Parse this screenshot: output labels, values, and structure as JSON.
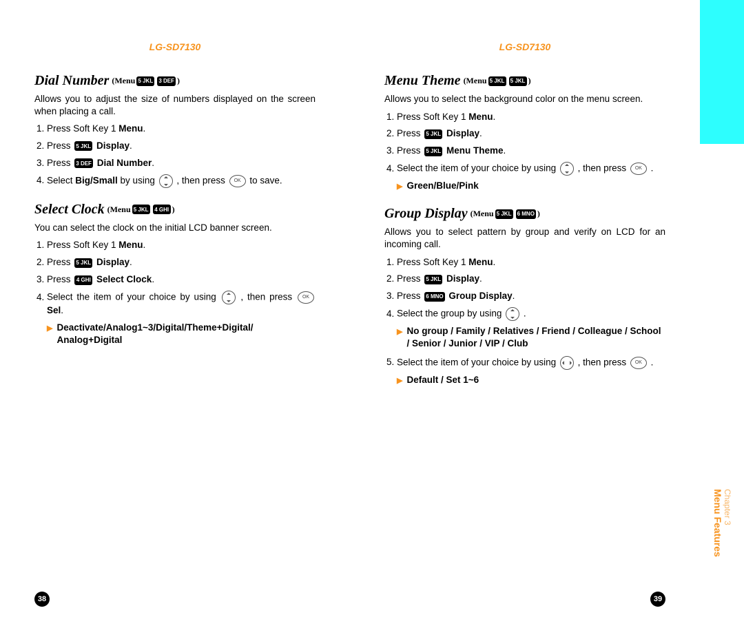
{
  "model": "LG-SD7130",
  "keys": {
    "k3": "3 DEF",
    "k4": "4 GHI",
    "k5": "5 JKL",
    "k6": "6 MNO",
    "ok": "OK"
  },
  "left": {
    "pageNum": "38",
    "sections": [
      {
        "title": "Dial Number",
        "crumbPrefix": "(Menu",
        "crumbKeys": [
          "k5",
          "k3"
        ],
        "crumbSuffix": ")",
        "desc": "Allows you to adjust the size of numbers displayed on the screen when placing a call.",
        "steps": [
          {
            "pre": "Press Soft Key 1 ",
            "bold": "Menu",
            "post": "."
          },
          {
            "pre": "Press ",
            "key": "k5",
            "bold": " Display",
            "post": "."
          },
          {
            "pre": "Press ",
            "key": "k3",
            "bold": " Dial Number",
            "post": "."
          },
          {
            "pre": "Select ",
            "bold": "Big/Small",
            "mid": " by using ",
            "nav": "vert",
            "post2": " , then press ",
            "ok": true,
            "tail": " to save."
          }
        ]
      },
      {
        "title": "Select Clock",
        "crumbPrefix": "(Menu",
        "crumbKeys": [
          "k5",
          "k4"
        ],
        "crumbSuffix": ")",
        "desc": "You can select the clock on the initial LCD banner screen.",
        "steps": [
          {
            "pre": "Press Soft Key 1 ",
            "bold": "Menu",
            "post": "."
          },
          {
            "pre": "Press ",
            "key": "k5",
            "bold": " Display",
            "post": "."
          },
          {
            "pre": "Press ",
            "key": "k4",
            "bold": " Select Clock",
            "post": "."
          },
          {
            "pre": "Select the item of your choice by using ",
            "nav": "vert",
            "post2": " , then press ",
            "ok": true,
            "bold2": " Sel",
            "tail": "."
          }
        ],
        "options": "Deactivate/Analog1~3/Digital/Theme+Digital/ Analog+Digital"
      }
    ]
  },
  "right": {
    "pageNum": "39",
    "sections": [
      {
        "title": "Menu Theme",
        "crumbPrefix": "(Menu",
        "crumbKeys": [
          "k5",
          "k5"
        ],
        "crumbSuffix": ")",
        "desc": "Allows you to select the background color on the menu screen.",
        "steps": [
          {
            "pre": "Press Soft Key 1 ",
            "bold": "Menu",
            "post": "."
          },
          {
            "pre": "Press ",
            "key": "k5",
            "bold": " Display",
            "post": "."
          },
          {
            "pre": "Press ",
            "key": "k5",
            "bold": " Menu Theme",
            "post": "."
          },
          {
            "pre": "Select the item of your choice by using ",
            "nav": "vert",
            "post2": " , then press ",
            "ok": true,
            "tail": " ."
          }
        ],
        "options": "Green/Blue/Pink"
      },
      {
        "title": "Group Display",
        "crumbPrefix": "(Menu",
        "crumbKeys": [
          "k5",
          "k6"
        ],
        "crumbSuffix": ")",
        "desc": "Allows you to select pattern by group and verify on LCD for an incoming call.",
        "steps": [
          {
            "pre": "Press Soft Key 1 ",
            "bold": "Menu",
            "post": "."
          },
          {
            "pre": "Press ",
            "key": "k5",
            "bold": " Display",
            "post": "."
          },
          {
            "pre": "Press ",
            "key": "k6",
            "bold": " Group Display",
            "post": "."
          },
          {
            "pre": "Select the group by using ",
            "nav": "vert",
            "tail": " ."
          }
        ],
        "options": "No group / Family / Relatives / Friend / Colleague / School / Senior / Junior / VIP / Club",
        "steps2": [
          {
            "num": 5,
            "pre": "Select the item of your choice by using ",
            "nav": "horiz",
            "post2": " , then press ",
            "ok": true,
            "tail": " ."
          }
        ],
        "options2": "Default / Set 1~6"
      }
    ]
  },
  "sideLabel": {
    "chapter": "Chapter 3",
    "feature": "Menu Features"
  }
}
